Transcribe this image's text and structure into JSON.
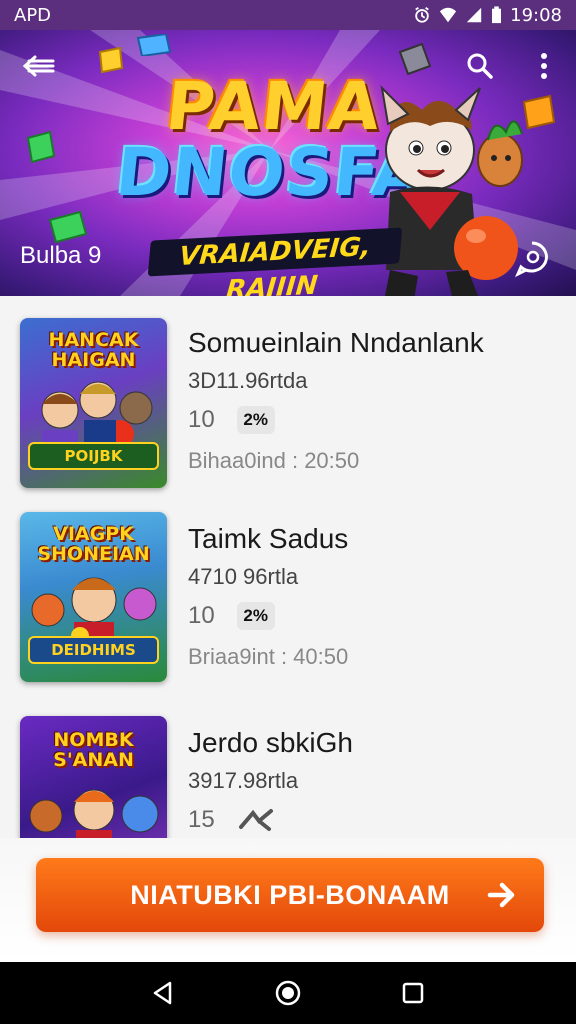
{
  "status_bar": {
    "carrier": "APD",
    "time": "19:08",
    "icons": [
      "alarm-icon",
      "wifi-icon",
      "signal-icon",
      "battery-icon"
    ]
  },
  "banner": {
    "title_line1": "PAMA",
    "title_line2": "DNOSFA",
    "subtitle": "VRAIADVEIG, RAIIIN",
    "label": "Bulba 9",
    "icons": [
      "back-arrow-icon",
      "search-icon",
      "more-vert-icon",
      "chat-icon"
    ]
  },
  "items": [
    {
      "thumb_title": "HANCAK\nHAIGAN",
      "thumb_foot": "POIJBK",
      "title": "Somueinlain Nndanlank",
      "size": "3D11.96rtda",
      "count": "10",
      "badge": "2%",
      "time": "Bihaa0ind : 20:50"
    },
    {
      "thumb_title": "VIAGPK\nSHONEIAN",
      "thumb_foot": "DEIDHIMS",
      "title": "Taimk Sadus",
      "size": "4710 96rtla",
      "count": "10",
      "badge": "2%",
      "time": "Briaa9int : 40:50"
    },
    {
      "thumb_title": "NOMBK\nS'ANAN",
      "thumb_foot": "",
      "title": "Jerdo sbkiGh",
      "size": "3917.98rtla",
      "count": "15",
      "badge": "",
      "time": ""
    }
  ],
  "cta": {
    "label": "NIATUBKI PBI-BONAAM"
  },
  "colors": {
    "status_bar": "#5b2f7d",
    "cta": "#f0600f",
    "title_yellow": "#ffcf2e",
    "title_blue": "#43b8ff"
  },
  "nav": {
    "icons": [
      "back-triangle-icon",
      "home-circle-icon",
      "recents-square-icon"
    ]
  }
}
